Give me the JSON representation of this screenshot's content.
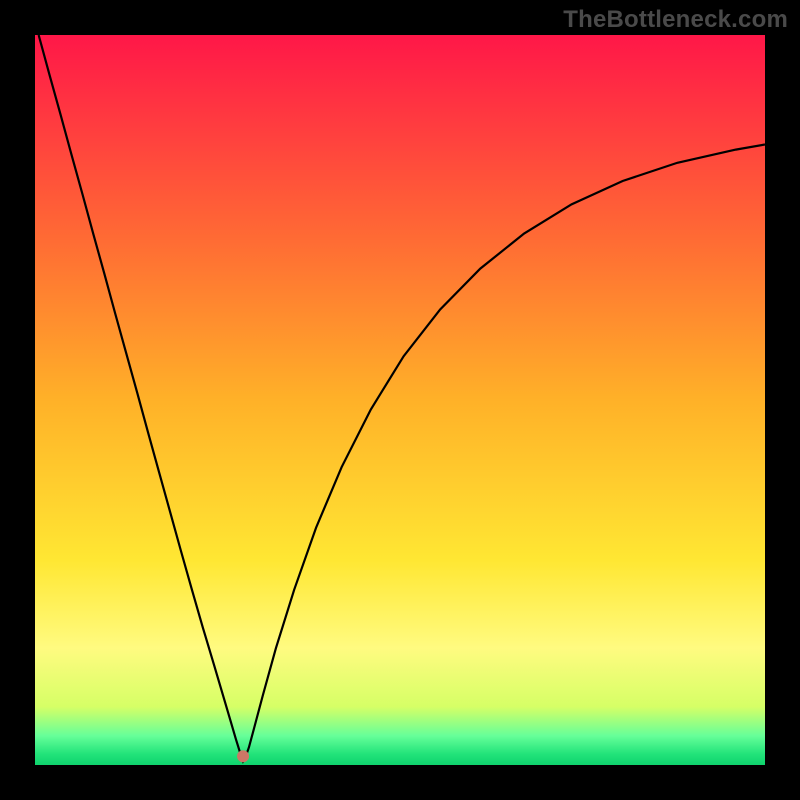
{
  "watermark": "TheBottleneck.com",
  "chart_data": {
    "type": "line",
    "title": "",
    "xlabel": "",
    "ylabel": "",
    "xlim": [
      0,
      1
    ],
    "ylim": [
      0,
      1
    ],
    "grid": false,
    "legend": false,
    "gradient_stops": [
      {
        "y": 1.0,
        "color": "#ff1748"
      },
      {
        "y": 0.72,
        "color": "#ff6b34"
      },
      {
        "y": 0.5,
        "color": "#ffb128"
      },
      {
        "y": 0.28,
        "color": "#ffe733"
      },
      {
        "y": 0.16,
        "color": "#fffb80"
      },
      {
        "y": 0.08,
        "color": "#d6ff66"
      },
      {
        "y": 0.04,
        "color": "#66ff99"
      },
      {
        "y": 0.015,
        "color": "#22e37a"
      },
      {
        "y": 0.0,
        "color": "#0fd36d"
      }
    ],
    "accent_dot": {
      "x": 0.285,
      "y": 0.012,
      "color": "#cc7766"
    },
    "series": [
      {
        "name": "bottleneck-curve",
        "color": "#000000",
        "x": [
          0.005,
          0.02,
          0.035,
          0.05,
          0.065,
          0.08,
          0.095,
          0.11,
          0.125,
          0.14,
          0.155,
          0.17,
          0.185,
          0.2,
          0.215,
          0.23,
          0.245,
          0.258,
          0.268,
          0.275,
          0.28,
          0.283,
          0.285,
          0.288,
          0.293,
          0.3,
          0.312,
          0.33,
          0.355,
          0.385,
          0.42,
          0.46,
          0.505,
          0.555,
          0.61,
          0.67,
          0.735,
          0.805,
          0.88,
          0.96,
          1.0
        ],
        "values": [
          1.0,
          0.945,
          0.891,
          0.836,
          0.782,
          0.727,
          0.673,
          0.618,
          0.564,
          0.51,
          0.455,
          0.401,
          0.347,
          0.293,
          0.24,
          0.188,
          0.138,
          0.094,
          0.06,
          0.036,
          0.02,
          0.01,
          0.005,
          0.01,
          0.024,
          0.05,
          0.095,
          0.16,
          0.24,
          0.325,
          0.408,
          0.487,
          0.56,
          0.624,
          0.68,
          0.728,
          0.768,
          0.8,
          0.825,
          0.843,
          0.85
        ]
      }
    ]
  }
}
